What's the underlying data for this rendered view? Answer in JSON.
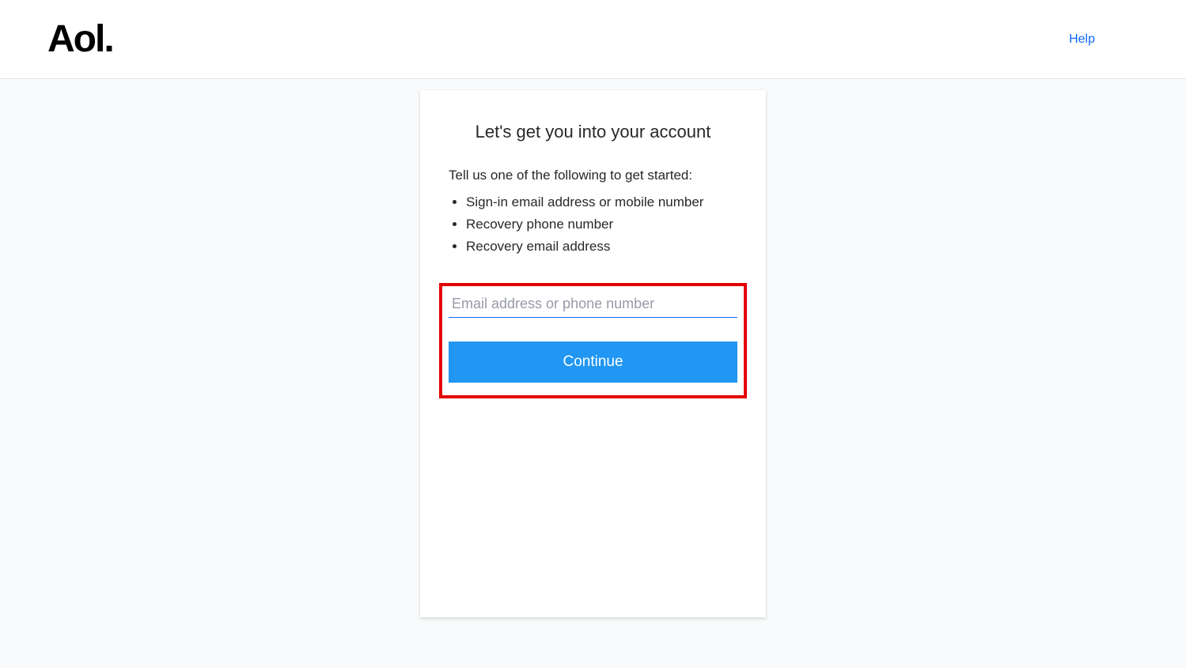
{
  "header": {
    "logo_text": "Aol.",
    "help_label": "Help"
  },
  "card": {
    "title": "Let's get you into your account",
    "subtitle": "Tell us one of the following to get started:",
    "options": [
      "Sign-in email address or mobile number",
      "Recovery phone number",
      "Recovery email address"
    ],
    "input_placeholder": "Email address or phone number",
    "continue_label": "Continue"
  }
}
